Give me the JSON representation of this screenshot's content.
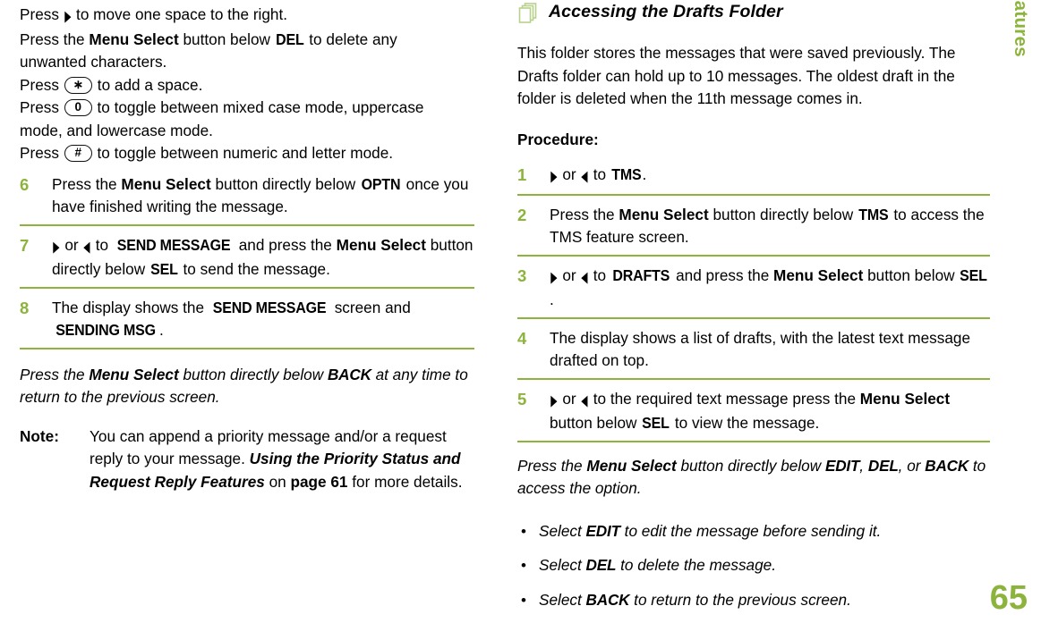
{
  "side_tab": {
    "chapter_label": "Advanced Features",
    "page_number": "65",
    "accent_color": "#8cb43c"
  },
  "left_column": {
    "intro_lines": [
      {
        "id": "l1",
        "text": "Press ▶ to move one space to the right."
      },
      {
        "id": "l2",
        "text": "Press the Menu Select button below DEL to delete any unwanted characters."
      },
      {
        "id": "l3",
        "text": "Press (*) to add a space."
      },
      {
        "id": "l4",
        "text": "Press (0) to toggle between mixed case mode, uppercase mode, and lowercase mode."
      },
      {
        "id": "l5",
        "text": "Press (#) to toggle between numeric and letter mode."
      }
    ],
    "fragments": {
      "press": "Press ",
      "press_the": "Press the ",
      "menu_select": "Menu Select",
      "to_move_right": " to move one space to the right.",
      "button_below": " button below ",
      "del": "DEL",
      "to_delete": " to delete any",
      "unwanted": "unwanted characters.",
      "star": "∗",
      "to_add_space": " to add a space.",
      "zero": "0",
      "toggle_case": " to toggle between mixed case mode, uppercase",
      "mode_lower": "mode, and lowercase mode.",
      "hash": "#",
      "toggle_numeric": " to toggle between numeric and letter mode."
    },
    "steps": [
      {
        "num": "6",
        "parts": {
          "a": "Press the ",
          "bold1": "Menu Select",
          "b": " button directly below ",
          "screen1": "OPTN",
          "c": " once you have finished writing the message."
        }
      },
      {
        "num": "7",
        "parts": {
          "a": " or ",
          "b": " to ",
          "screen1": "SEND MESSAGE",
          "c": " and press the ",
          "bold1": "Menu Select",
          "d": " button directly below ",
          "screen2": "SEL",
          "e": " to send the message."
        }
      },
      {
        "num": "8",
        "parts": {
          "a": "The display shows the ",
          "screen1": "SEND MESSAGE",
          "b": " screen and ",
          "screen2": "SENDING MSG",
          "c": "."
        }
      }
    ],
    "callout": {
      "a": "Press the ",
      "bold1": "Menu Select",
      "b": " button directly below ",
      "screen1": "BACK",
      "c": " at any time to return to the previous screen."
    },
    "note": {
      "label": "Note:",
      "a": "You can append a priority message and/or a request reply to your message. ",
      "bold_italic": "Using the Priority Status and Request Reply Features",
      "b": " on ",
      "bold1": "page 61",
      "c": " for more details."
    }
  },
  "right_column": {
    "heading": {
      "icon": "stacked-pages-icon",
      "title": "Accessing the Drafts Folder"
    },
    "intro": "This folder stores the messages that were saved previously. The Drafts folder can hold up to 10 messages. The oldest draft in the folder is deleted when the 11th message comes in.",
    "procedure_label": "Procedure:",
    "steps": [
      {
        "num": "1",
        "parts": {
          "a": " or ",
          "b": " to ",
          "screen1": "TMS",
          "c": "."
        }
      },
      {
        "num": "2",
        "parts": {
          "a": "Press the ",
          "bold1": "Menu Select",
          "b": " button directly below ",
          "screen1": "TMS",
          "c": " to access the TMS feature screen."
        }
      },
      {
        "num": "3",
        "parts": {
          "a": " or ",
          "b": " to ",
          "screen1": "DRAFTS",
          "c": " and press the ",
          "bold1": "Menu Select",
          "d": " button below ",
          "screen2": "SEL",
          "e": "."
        }
      },
      {
        "num": "4",
        "parts": {
          "a": "The display shows a list of drafts, with the latest text message drafted on top."
        }
      },
      {
        "num": "5",
        "parts": {
          "a": " or ",
          "b": " to the required text message press the ",
          "bold1": "Menu Select",
          "c": " button below ",
          "screen1": "SEL",
          "d": " to view the message."
        }
      }
    ],
    "callout": {
      "a": "Press the ",
      "bold1": "Menu Select",
      "b": " button directly below ",
      "screen1": "EDIT",
      "c": ", ",
      "screen2": "DEL",
      "d": ", or ",
      "screen3": "BACK",
      "e": " to access the option."
    },
    "bullets": [
      {
        "a": "Select ",
        "screen1": "EDIT",
        "b": " to edit the message before sending it."
      },
      {
        "a": "Select ",
        "screen1": "DEL",
        "b": " to delete the message."
      },
      {
        "a": "Select ",
        "screen1": "BACK",
        "b": " to return to the previous screen."
      }
    ]
  },
  "glyphs": {
    "arrow_right": "▶",
    "arrow_left": "◀"
  }
}
